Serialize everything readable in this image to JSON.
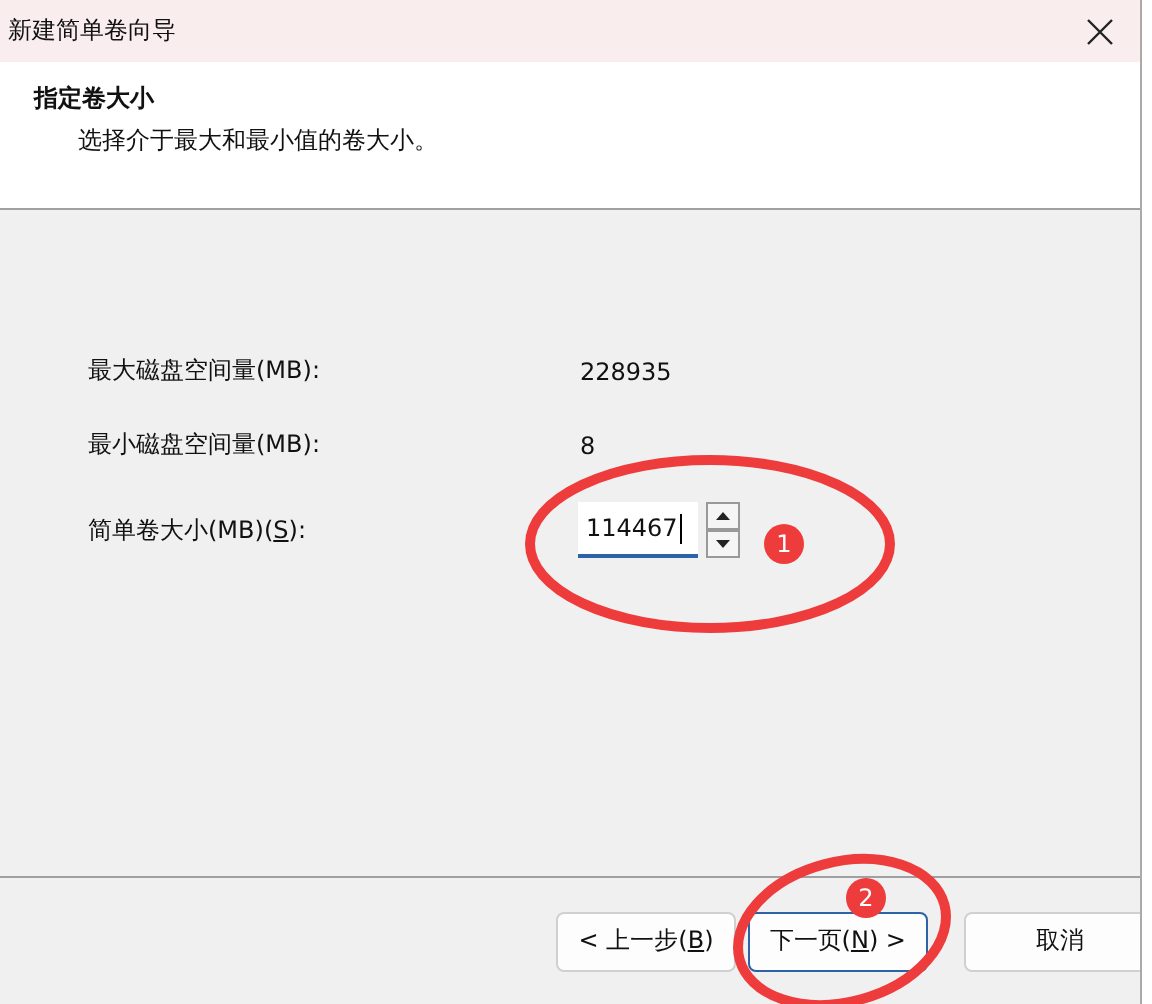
{
  "window": {
    "title": "新建简单卷向导"
  },
  "header": {
    "title": "指定卷大小",
    "subtitle": "选择介于最大和最小值的卷大小。"
  },
  "fields": [
    {
      "kind": "readout",
      "label": "最大磁盘空间量(MB):",
      "value": "228935"
    },
    {
      "kind": "readout",
      "label": "最小磁盘空间量(MB):",
      "value": "8"
    },
    {
      "kind": "spinner",
      "label": "简单卷大小(MB)(",
      "mnemonic": "S",
      "label_after": "):",
      "value": "114467",
      "focused": true
    }
  ],
  "buttons": [
    {
      "before": "< 上一步(",
      "mnemonic": "B",
      "after": ")",
      "default": false
    },
    {
      "before": "下一页(",
      "mnemonic": "N",
      "after": ") >",
      "default": true
    },
    {
      "before": "取消",
      "default": false
    }
  ],
  "annotations": [
    {
      "kind": "ellipse",
      "number": "1"
    },
    {
      "kind": "ellipse",
      "number": "2"
    }
  ]
}
